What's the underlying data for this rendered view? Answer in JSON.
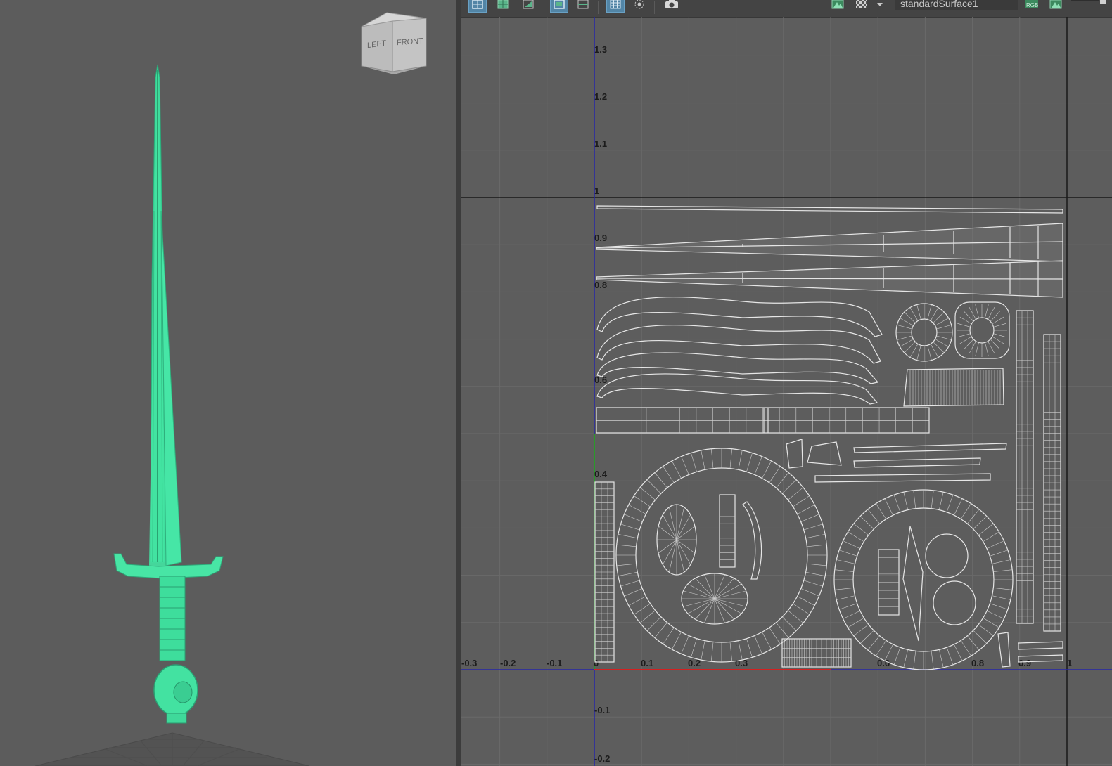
{
  "viewport": {
    "viewcube_left": "LEFT",
    "viewcube_front": "FRONT",
    "wireframe_color": "#3ee7a3"
  },
  "uv_editor": {
    "shader_name": "standardSurface1",
    "toolbar_icons": [
      "uv-layout-icon",
      "uv-grid-icon",
      "uv-shell-icon",
      "display-uv-icon",
      "display-edges-icon",
      "grid-icon",
      "isolate-icon",
      "snapshot-icon",
      "image-icon",
      "checker-icon",
      "dropdown-icon",
      "rgb-icon",
      "alpha-icon"
    ],
    "u_labels": [
      "-0.3",
      "-0.2",
      "-0.1",
      "0",
      "0.1",
      "0.2",
      "0.3",
      "0.6",
      "0.8",
      "0.9",
      "1"
    ],
    "v_labels": [
      "1.3",
      "1.2",
      "1.1",
      "1",
      "0.9",
      "0.8",
      "0.6",
      "0.4",
      "-0.1",
      "-0.2"
    ],
    "colors": {
      "background": "#5d5d5d",
      "grid": "#6a6a6a",
      "uv_wire": "#e6e6e6",
      "u_axis": "#d42020",
      "v_axis": "#2a9a2a",
      "frame_axis": "#2626a8"
    }
  }
}
